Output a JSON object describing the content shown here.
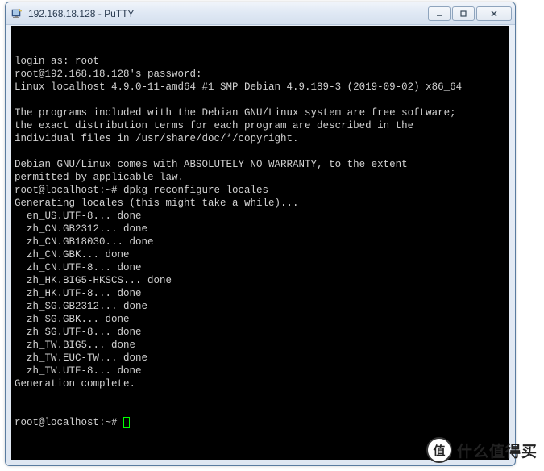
{
  "window": {
    "title": "192.168.18.128 - PuTTY",
    "controls": {
      "minimize": "minimize",
      "maximize": "maximize",
      "close": "close"
    }
  },
  "terminal": {
    "lines": [
      "login as: root",
      "root@192.168.18.128's password:",
      "Linux localhost 4.9.0-11-amd64 #1 SMP Debian 4.9.189-3 (2019-09-02) x86_64",
      "",
      "The programs included with the Debian GNU/Linux system are free software;",
      "the exact distribution terms for each program are described in the",
      "individual files in /usr/share/doc/*/copyright.",
      "",
      "Debian GNU/Linux comes with ABSOLUTELY NO WARRANTY, to the extent",
      "permitted by applicable law.",
      "root@localhost:~# dpkg-reconfigure locales",
      "Generating locales (this might take a while)...",
      "  en_US.UTF-8... done",
      "  zh_CN.GB2312... done",
      "  zh_CN.GB18030... done",
      "  zh_CN.GBK... done",
      "  zh_CN.UTF-8... done",
      "  zh_HK.BIG5-HKSCS... done",
      "  zh_HK.UTF-8... done",
      "  zh_SG.GB2312... done",
      "  zh_SG.GBK... done",
      "  zh_SG.UTF-8... done",
      "  zh_TW.BIG5... done",
      "  zh_TW.EUC-TW... done",
      "  zh_TW.UTF-8... done",
      "Generation complete."
    ],
    "prompt": "root@localhost:~# "
  },
  "watermark": {
    "badge": "值",
    "text": "什么值得买"
  }
}
